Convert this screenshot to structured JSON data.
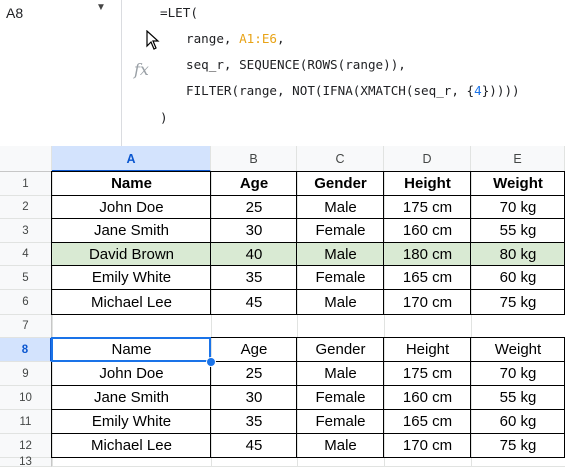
{
  "name_box": {
    "value": "A8",
    "arrow": "▼"
  },
  "formula": {
    "line1": "=LET(",
    "line2_pre": "range, ",
    "line2_ref": "A1:E6",
    "line2_post": ",",
    "line3": "seq_r, SEQUENCE(ROWS(range)),",
    "line4_pre": "FILTER(range, NOT(IFNA(XMATCH(seq_r, {",
    "line4_num": "4",
    "line4_post": "}))))",
    "line5": ")",
    "fx_label": "fx",
    "ref_color": "#e8a317",
    "number_color": "#1a73e8"
  },
  "columns": [
    "A",
    "B",
    "C",
    "D",
    "E"
  ],
  "selected_column": "A",
  "rows": [
    {
      "num": "1",
      "cells": [
        "Name",
        "Age",
        "Gender",
        "Height",
        "Weight"
      ],
      "style": "header"
    },
    {
      "num": "2",
      "cells": [
        "John Doe",
        "25",
        "Male",
        "175 cm",
        "70 kg"
      ]
    },
    {
      "num": "3",
      "cells": [
        "Jane Smith",
        "30",
        "Female",
        "160 cm",
        "55 kg"
      ]
    },
    {
      "num": "4",
      "cells": [
        "David Brown",
        "40",
        "Male",
        "180 cm",
        "80 kg"
      ],
      "style": "highlight"
    },
    {
      "num": "5",
      "cells": [
        "Emily White",
        "35",
        "Female",
        "165 cm",
        "60 kg"
      ]
    },
    {
      "num": "6",
      "cells": [
        "Michael Lee",
        "45",
        "Male",
        "170 cm",
        "75 kg"
      ]
    },
    {
      "num": "7",
      "cells": [
        "",
        "",
        "",
        "",
        ""
      ]
    },
    {
      "num": "8",
      "cells": [
        "Name",
        "Age",
        "Gender",
        "Height",
        "Weight"
      ],
      "selected": true
    },
    {
      "num": "9",
      "cells": [
        "John Doe",
        "25",
        "Male",
        "175 cm",
        "70 kg"
      ]
    },
    {
      "num": "10",
      "cells": [
        "Jane Smith",
        "30",
        "Female",
        "160 cm",
        "55 kg"
      ]
    },
    {
      "num": "11",
      "cells": [
        "Emily White",
        "35",
        "Female",
        "165 cm",
        "60 kg"
      ]
    },
    {
      "num": "12",
      "cells": [
        "Michael Lee",
        "45",
        "Male",
        "170 cm",
        "75 kg"
      ]
    },
    {
      "num": "13",
      "cells": [
        "",
        "",
        "",
        "",
        ""
      ]
    }
  ],
  "colors": {
    "highlight": "#d9ead3",
    "selection": "#1a73e8",
    "header_bg": "#f8f9fa"
  }
}
